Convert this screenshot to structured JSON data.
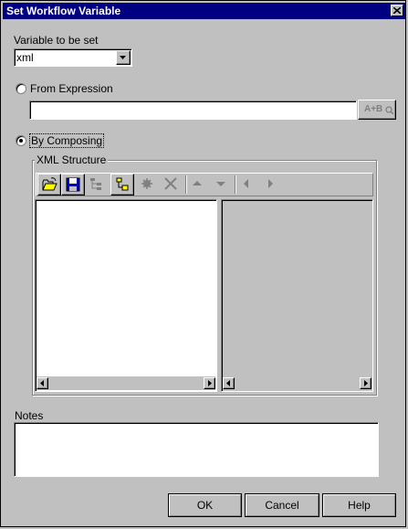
{
  "window": {
    "title": "Set Workflow Variable"
  },
  "variable": {
    "label": "Variable to be set",
    "selected": "xml"
  },
  "from_expression": {
    "label": "From Expression",
    "value": "",
    "builder_label": "A+B"
  },
  "by_composing": {
    "label": "By Composing",
    "selected": true
  },
  "xml_structure": {
    "title": "XML Structure",
    "toolbar": [
      "open-folder-icon",
      "save-disk-icon",
      "tree-indent-icon",
      "tree-add-child-icon",
      "gear-icon",
      "delete-x-icon",
      "arrow-up-icon",
      "arrow-down-icon",
      "arrow-left-icon",
      "arrow-right-icon"
    ]
  },
  "notes": {
    "label": "Notes",
    "value": ""
  },
  "buttons": {
    "ok": "OK",
    "cancel": "Cancel",
    "help": "Help"
  },
  "colors": {
    "titlebar": "#000080",
    "face": "#c0c0c0"
  }
}
